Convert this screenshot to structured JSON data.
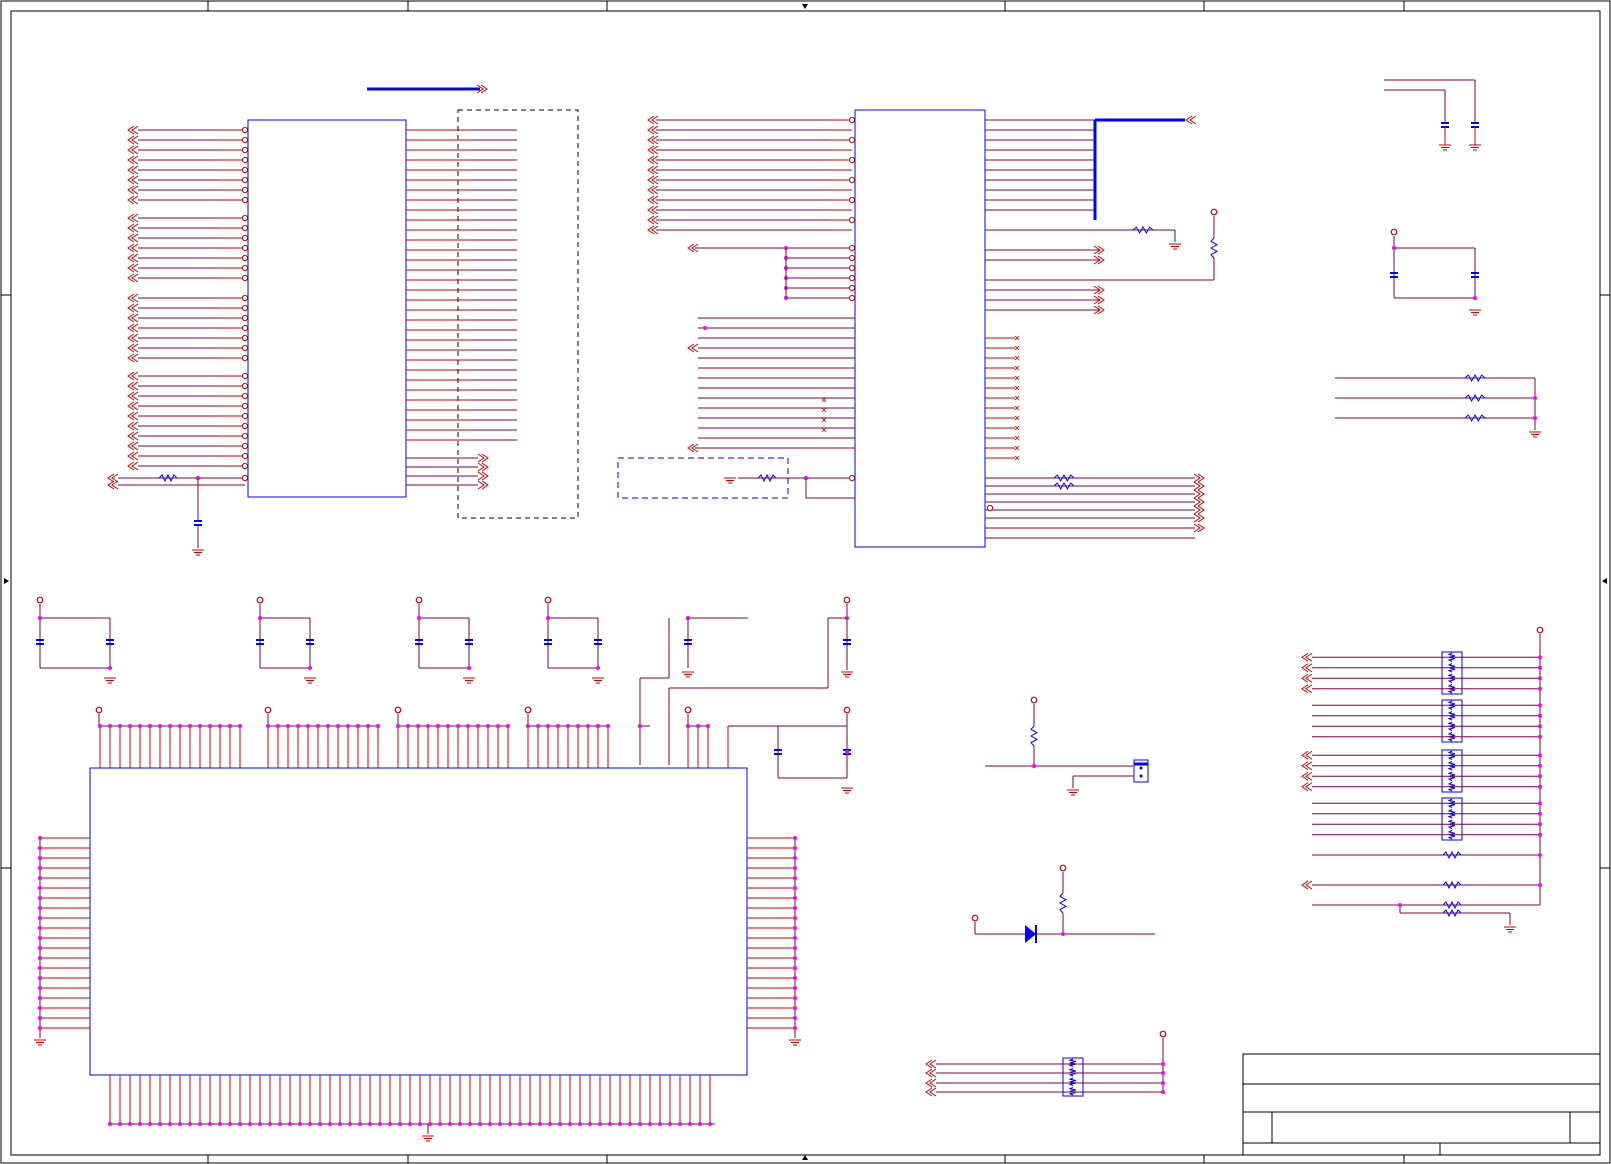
{
  "sheet": {
    "title": "",
    "border_color": "#000000",
    "wire_color": "#cc0000",
    "net_color": "#800040",
    "part_color": "#0000ff",
    "junction_color": "#ff00ff",
    "bus_color": "#0000ff",
    "power_color": "#cc0000",
    "ground_color": "#cc0000"
  },
  "title_block": {
    "title": "",
    "size": "",
    "document_number": "",
    "revision": "",
    "date": "",
    "sheet": ""
  },
  "symbols": {
    "ic": "ic-body",
    "resistor": "resistor-symbol",
    "capacitor": "capacitor-symbol",
    "ground": "ground-icon",
    "power": "power-port-icon",
    "offpage": "offpage-connector-icon",
    "diode": "diode-icon",
    "jumper": "jumper-icon",
    "resistor_network": "resistor-network-icon",
    "no_connect": "no-connect-icon"
  }
}
